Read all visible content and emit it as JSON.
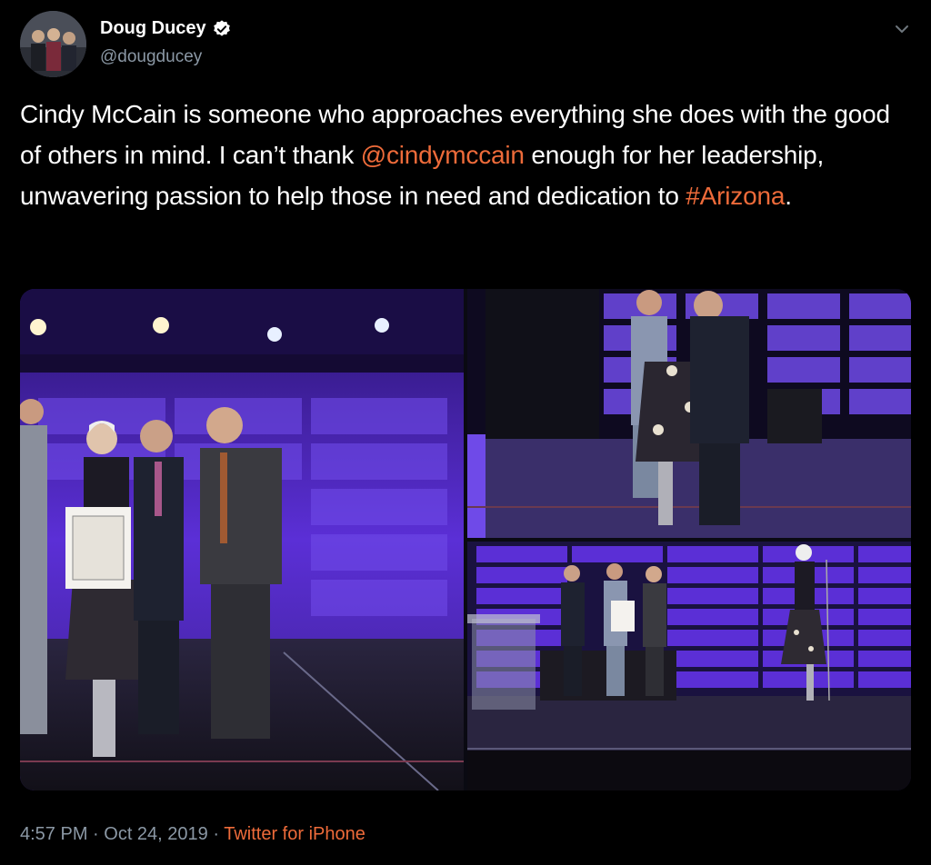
{
  "author": {
    "name": "Doug Ducey",
    "handle": "@dougducey",
    "verified_icon": "verified-badge-icon"
  },
  "tweet": {
    "text_1": "Cindy McCain is someone who approaches everything she does with the good of others in mind. I can’t thank ",
    "mention": "@cindymccain",
    "text_2": " enough for her leadership, unwavering passion to help those in need and dedication to ",
    "hashtag": "#Arizona",
    "text_3": "."
  },
  "meta": {
    "time": "4:57 PM",
    "sep1": " · ",
    "date": "Oct 24, 2019",
    "sep2": " · ",
    "source": "Twitter for iPhone"
  },
  "colors": {
    "background": "#000000",
    "link": "#ee6b3a",
    "secondary_text": "#8b98a5",
    "stage_purple": "#5b2fd6"
  }
}
